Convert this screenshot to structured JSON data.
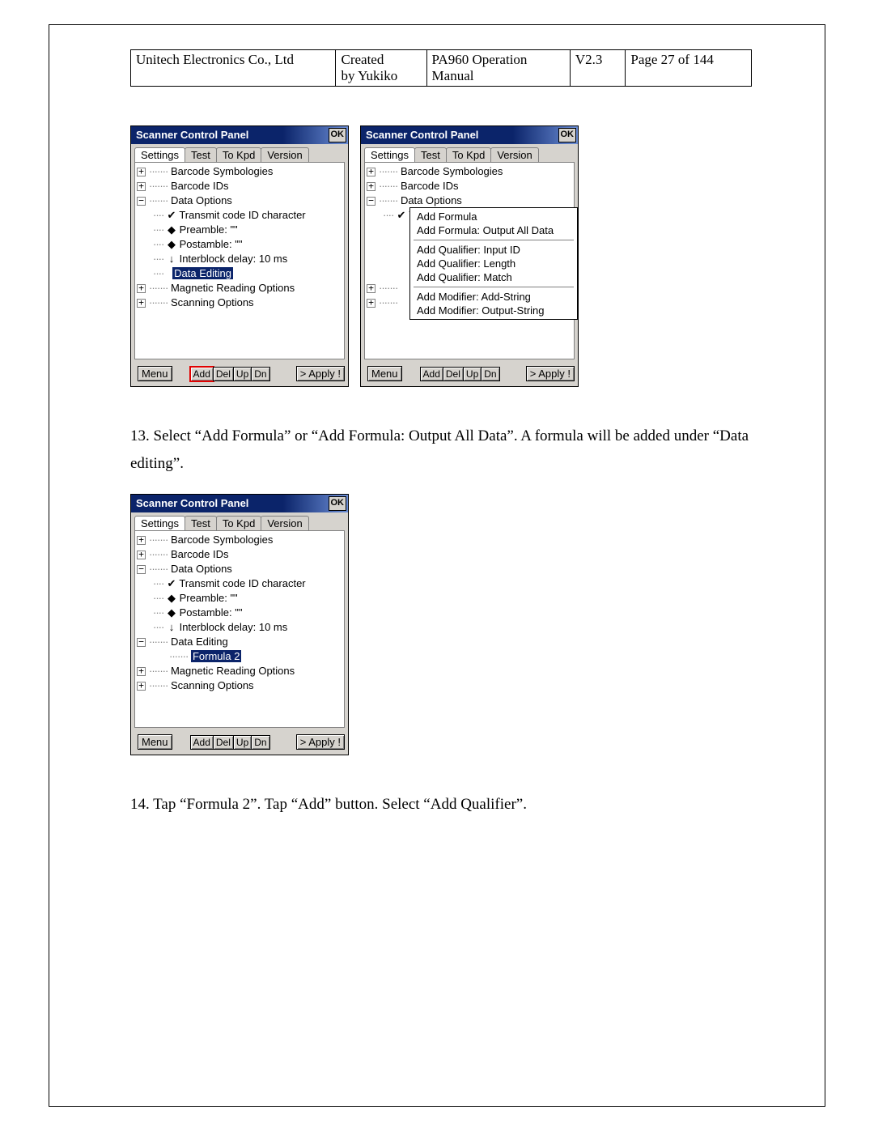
{
  "header": {
    "company": "Unitech Electronics Co., Ltd",
    "created1": "Created",
    "created2": "by Yukiko",
    "doc1": "PA960 Operation",
    "doc2": "Manual",
    "version": "V2.3",
    "page": "Page 27 of 144"
  },
  "scp": {
    "title": "Scanner Control Panel",
    "ok": "OK",
    "tabs": {
      "settings": "Settings",
      "test": "Test",
      "tokpd": "To Kpd",
      "version": "Version"
    },
    "items": {
      "barcode_sym": "Barcode Symbologies",
      "barcode_ids": "Barcode IDs",
      "data_options": "Data Options",
      "transmit": "Transmit code ID character",
      "preamble": "Preamble: \"\"",
      "postamble": "Postamble: \"\"",
      "interblock": "Interblock delay: 10 ms",
      "data_editing": "Data Editing",
      "formula2": "Formula 2",
      "magnetic": "Magnetic Reading Options",
      "scanning": "Scanning Options"
    },
    "buttons": {
      "menu": "Menu",
      "add": "Add",
      "del": "Del",
      "up": "Up",
      "dn": "Dn",
      "apply": "> Apply !"
    }
  },
  "menu": {
    "add_formula": "Add Formula",
    "add_formula_all": "Add Formula: Output All Data",
    "q_input": "Add Qualifier: Input ID",
    "q_length": "Add Qualifier: Length",
    "q_match": "Add Qualifier: Match",
    "m_addstr": "Add Modifier: Add-String",
    "m_outstr": "Add Modifier: Output-String"
  },
  "text": {
    "step13": "13. Select “Add Formula” or “Add Formula: Output All Data”. A formula will be added under “Data editing”.",
    "step14": "14. Tap “Formula 2”. Tap “Add” button. Select “Add Qualifier”."
  }
}
